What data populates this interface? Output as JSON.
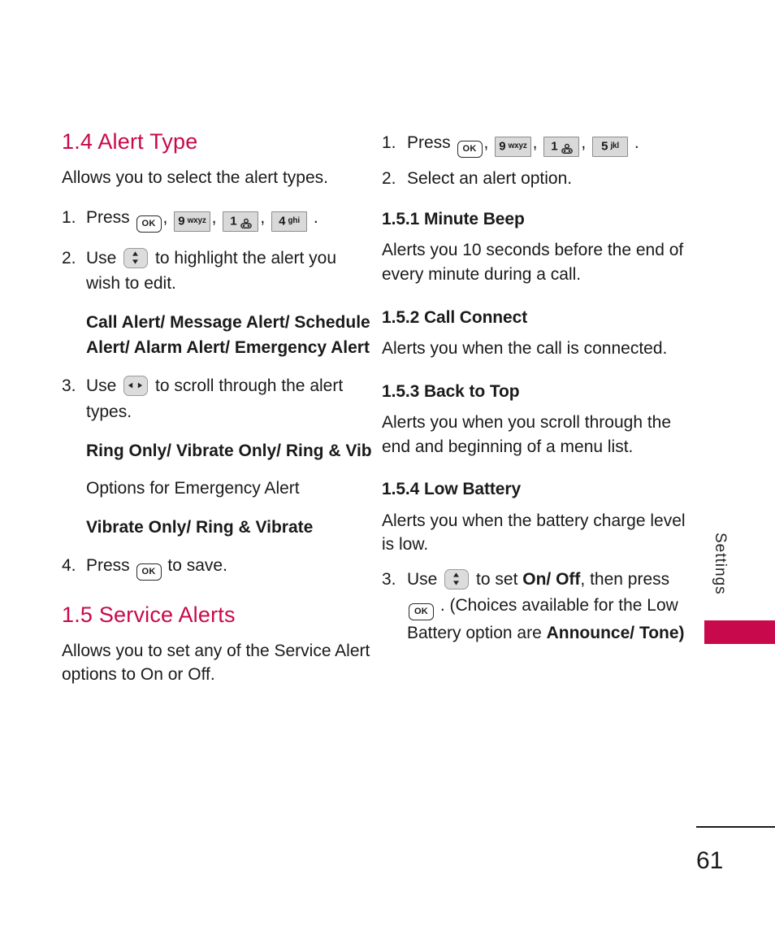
{
  "page": {
    "number": "61",
    "side_tab_label": "Settings",
    "accent_color": "#c8094b"
  },
  "left_column": {
    "section_heading": "1.4 Alert Type",
    "intro": "Allows you to select the alert types.",
    "step1": {
      "num": "1.",
      "text_before": "Press",
      "keys": [
        {
          "name": "ok-key",
          "label": "OK",
          "type": "ok"
        },
        {
          "name": "key-9",
          "digit": "9",
          "letters": "wxyz",
          "type": "num"
        },
        {
          "name": "key-1",
          "digit": "1",
          "letters": "",
          "type": "num-voicemail"
        },
        {
          "name": "key-4",
          "digit": "4",
          "letters": "ghi",
          "type": "num"
        }
      ],
      "separator": ",",
      "terminator": "."
    },
    "step2": {
      "num": "2.",
      "text_before": "Use",
      "nav_key": "up-down-nav-key",
      "text_after": "to highlight the alert you wish to edit."
    },
    "step2_options": "Call Alert/ Message Alert/ Schedule Alert/ Alarm Alert/ Emergency Alert",
    "step3": {
      "num": "3.",
      "text_before": "Use",
      "nav_key": "left-right-nav-key",
      "text_after": "to scroll through the alert types."
    },
    "step3_options": "Ring Only/ Vibrate Only/ Ring & Vib",
    "step3_note": "Options for Emergency Alert",
    "step3_options2": "Vibrate Only/ Ring & Vibrate",
    "step4": {
      "num": "4.",
      "text_before": "Press",
      "ok_key": "OK",
      "text_after": "to save."
    },
    "section_heading_2": "1.5 Service Alerts",
    "intro_2": "Allows you to set any of the Service Alert options to On or Off."
  },
  "right_column": {
    "step1": {
      "num": "1.",
      "text_before": "Press",
      "keys": [
        {
          "name": "ok-key",
          "label": "OK",
          "type": "ok"
        },
        {
          "name": "key-9",
          "digit": "9",
          "letters": "wxyz",
          "type": "num"
        },
        {
          "name": "key-1",
          "digit": "1",
          "letters": "",
          "type": "num-voicemail"
        },
        {
          "name": "key-5",
          "digit": "5",
          "letters": "jkl",
          "type": "num"
        }
      ],
      "terminator": "."
    },
    "step2": {
      "num": "2.",
      "text": "Select an alert option."
    },
    "subsections": [
      {
        "heading": "1.5.1 Minute Beep",
        "body": "Alerts you 10 seconds before the end of every minute during a call."
      },
      {
        "heading": "1.5.2 Call Connect",
        "body": "Alerts you when the call is connected."
      },
      {
        "heading": "1.5.3 Back to Top",
        "body": "Alerts you when you scroll through the end and beginning of a menu list."
      },
      {
        "heading": "1.5.4 Low Battery",
        "body": "Alerts you when the battery charge level is low."
      }
    ],
    "step3": {
      "num": "3.",
      "text_before": "Use",
      "nav_key": "up-down-nav-key",
      "text_mid1": "to set",
      "bold1": "On/ Off",
      "text_mid2": ", then press",
      "ok_key": "OK",
      "text_mid3": ". (Choices available for the Low Battery option are",
      "bold2": "Announce/ Tone)"
    }
  }
}
